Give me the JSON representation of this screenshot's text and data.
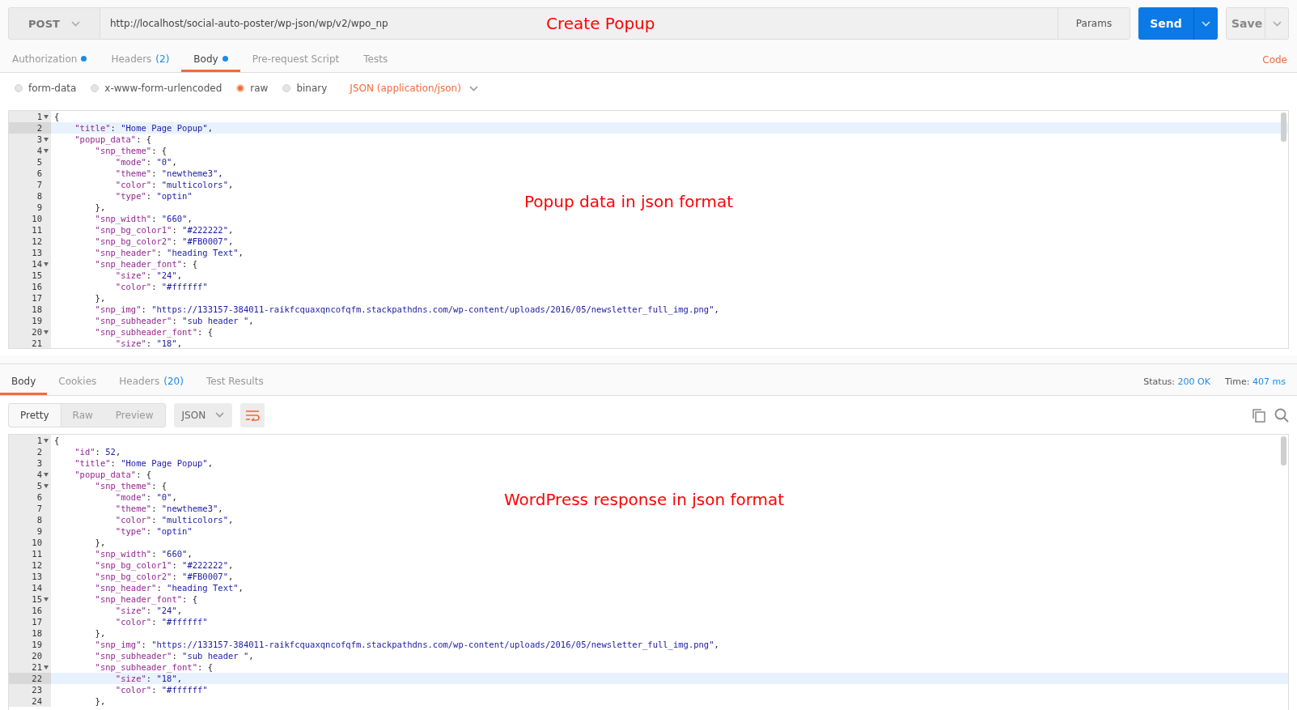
{
  "request_bar": {
    "method": "POST",
    "url": "http://localhost/social-auto-poster/wp-json/wp/v2/wpo_np",
    "params_button": "Params",
    "send_button": "Send",
    "save_button": "Save",
    "annotation": "Create Popup"
  },
  "request_tabs": [
    {
      "label": "Authorization",
      "dot": true,
      "selected": false
    },
    {
      "label": "Headers",
      "count": "(2)",
      "dot": false,
      "selected": false
    },
    {
      "label": "Body",
      "dot": true,
      "selected": true
    },
    {
      "label": "Pre-request Script",
      "dot": false,
      "selected": false
    },
    {
      "label": "Tests",
      "dot": false,
      "selected": false
    }
  ],
  "code_link": "Code",
  "body_types": [
    {
      "label": "form-data",
      "selected": false
    },
    {
      "label": "x-www-form-urlencoded",
      "selected": false
    },
    {
      "label": "raw",
      "selected": true
    },
    {
      "label": "binary",
      "selected": false
    }
  ],
  "content_type": "JSON (application/json)",
  "request_editor": {
    "annotation": "Popup data in json format",
    "lines": [
      {
        "num": "1",
        "text": "{",
        "foldable": true,
        "current": false
      },
      {
        "num": "2",
        "text": "    \"title\": \"Home Page Popup\",",
        "foldable": false,
        "current": true
      },
      {
        "num": "3",
        "text": "    \"popup_data\": {",
        "foldable": true,
        "current": false
      },
      {
        "num": "4",
        "text": "        \"snp_theme\": {",
        "foldable": true,
        "current": false
      },
      {
        "num": "5",
        "text": "            \"mode\": \"0\",",
        "foldable": false,
        "current": false
      },
      {
        "num": "6",
        "text": "            \"theme\": \"newtheme3\",",
        "foldable": false,
        "current": false
      },
      {
        "num": "7",
        "text": "            \"color\": \"multicolors\",",
        "foldable": false,
        "current": false
      },
      {
        "num": "8",
        "text": "            \"type\": \"optin\"",
        "foldable": false,
        "current": false
      },
      {
        "num": "9",
        "text": "        },",
        "foldable": false,
        "current": false
      },
      {
        "num": "10",
        "text": "        \"snp_width\": \"660\",",
        "foldable": false,
        "current": false
      },
      {
        "num": "11",
        "text": "        \"snp_bg_color1\": \"#222222\",",
        "foldable": false,
        "current": false
      },
      {
        "num": "12",
        "text": "        \"snp_bg_color2\": \"#FB0007\",",
        "foldable": false,
        "current": false
      },
      {
        "num": "13",
        "text": "        \"snp_header\": \"heading Text\",",
        "foldable": false,
        "current": false
      },
      {
        "num": "14",
        "text": "        \"snp_header_font\": {",
        "foldable": true,
        "current": false
      },
      {
        "num": "15",
        "text": "            \"size\": \"24\",",
        "foldable": false,
        "current": false
      },
      {
        "num": "16",
        "text": "            \"color\": \"#ffffff\"",
        "foldable": false,
        "current": false
      },
      {
        "num": "17",
        "text": "        },",
        "foldable": false,
        "current": false
      },
      {
        "num": "18",
        "text": "        \"snp_img\": \"https://133157-384011-raikfcquaxqncofqfm.stackpathdns.com/wp-content/uploads/2016/05/newsletter_full_img.png\",",
        "foldable": false,
        "current": false
      },
      {
        "num": "19",
        "text": "        \"snp_subheader\": \"sub header \",",
        "foldable": false,
        "current": false
      },
      {
        "num": "20",
        "text": "        \"snp_subheader_font\": {",
        "foldable": true,
        "current": false
      },
      {
        "num": "21",
        "text": "            \"size\": \"18\",",
        "foldable": false,
        "current": false
      }
    ]
  },
  "response_tabs": [
    {
      "label": "Body",
      "selected": true
    },
    {
      "label": "Cookies",
      "selected": false
    },
    {
      "label": "Headers",
      "count": "(20)",
      "selected": false
    },
    {
      "label": "Test Results",
      "selected": false
    }
  ],
  "status": {
    "label": "Status:",
    "value": "200 OK"
  },
  "time": {
    "label": "Time:",
    "value": "407 ms"
  },
  "view_modes": [
    {
      "label": "Pretty",
      "selected": true
    },
    {
      "label": "Raw",
      "selected": false
    },
    {
      "label": "Preview",
      "selected": false
    }
  ],
  "format": "JSON",
  "response_editor": {
    "annotation": "WordPress response in json format",
    "lines": [
      {
        "num": "1",
        "text": "{",
        "foldable": true,
        "current": false
      },
      {
        "num": "2",
        "text": "    \"id\": 52,",
        "foldable": false,
        "current": false
      },
      {
        "num": "3",
        "text": "    \"title\": \"Home Page Popup\",",
        "foldable": false,
        "current": false
      },
      {
        "num": "4",
        "text": "    \"popup_data\": {",
        "foldable": true,
        "current": false
      },
      {
        "num": "5",
        "text": "        \"snp_theme\": {",
        "foldable": true,
        "current": false
      },
      {
        "num": "6",
        "text": "            \"mode\": \"0\",",
        "foldable": false,
        "current": false
      },
      {
        "num": "7",
        "text": "            \"theme\": \"newtheme3\",",
        "foldable": false,
        "current": false
      },
      {
        "num": "8",
        "text": "            \"color\": \"multicolors\",",
        "foldable": false,
        "current": false
      },
      {
        "num": "9",
        "text": "            \"type\": \"optin\"",
        "foldable": false,
        "current": false
      },
      {
        "num": "10",
        "text": "        },",
        "foldable": false,
        "current": false
      },
      {
        "num": "11",
        "text": "        \"snp_width\": \"660\",",
        "foldable": false,
        "current": false
      },
      {
        "num": "12",
        "text": "        \"snp_bg_color1\": \"#222222\",",
        "foldable": false,
        "current": false
      },
      {
        "num": "13",
        "text": "        \"snp_bg_color2\": \"#FB0007\",",
        "foldable": false,
        "current": false
      },
      {
        "num": "14",
        "text": "        \"snp_header\": \"heading Text\",",
        "foldable": false,
        "current": false
      },
      {
        "num": "15",
        "text": "        \"snp_header_font\": {",
        "foldable": true,
        "current": false
      },
      {
        "num": "16",
        "text": "            \"size\": \"24\",",
        "foldable": false,
        "current": false
      },
      {
        "num": "17",
        "text": "            \"color\": \"#ffffff\"",
        "foldable": false,
        "current": false
      },
      {
        "num": "18",
        "text": "        },",
        "foldable": false,
        "current": false
      },
      {
        "num": "19",
        "text": "        \"snp_img\": \"https://133157-384011-raikfcquaxqncofqfm.stackpathdns.com/wp-content/uploads/2016/05/newsletter_full_img.png\",",
        "foldable": false,
        "current": false
      },
      {
        "num": "20",
        "text": "        \"snp_subheader\": \"sub header \",",
        "foldable": false,
        "current": false
      },
      {
        "num": "21",
        "text": "        \"snp_subheader_font\": {",
        "foldable": true,
        "current": false
      },
      {
        "num": "22",
        "text": "            \"size\": \"18\",",
        "foldable": false,
        "current": true
      },
      {
        "num": "23",
        "text": "            \"color\": \"#ffffff\"",
        "foldable": false,
        "current": false
      },
      {
        "num": "24",
        "text": "        },",
        "foldable": false,
        "current": false
      }
    ]
  }
}
